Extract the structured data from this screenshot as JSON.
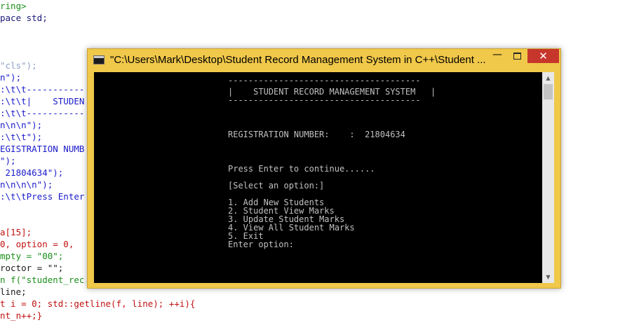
{
  "editor": {
    "lines": [
      {
        "text": "ring>",
        "color": "#1b8f1b"
      },
      {
        "text": "pace std;",
        "color": "#1a1a7a"
      },
      {
        "text": "",
        "color": "#000000"
      },
      {
        "text": "",
        "color": "#000000"
      },
      {
        "text": "\"cls\");",
        "color": "#8fa0c8"
      },
      {
        "text": "n\");",
        "color": "#1a1acb"
      },
      {
        "text": ":\\t\\t-----------",
        "color": "#1a1acb"
      },
      {
        "text": ":\\t\\t|    STUDEN",
        "color": "#1a1acb"
      },
      {
        "text": ":\\t\\t-----------",
        "color": "#1a1acb"
      },
      {
        "text": "n\\n\\n\");",
        "color": "#1a1acb"
      },
      {
        "text": ":\\t\\t\");",
        "color": "#1a1acb"
      },
      {
        "text": "EGISTRATION NUMB",
        "color": "#1a1acb"
      },
      {
        "text": "\");",
        "color": "#1a1acb"
      },
      {
        "text": " 21804634\");",
        "color": "#1a1acb"
      },
      {
        "text": "n\\n\\n\\n\");",
        "color": "#1a1acb"
      },
      {
        "text": ":\\t\\tPress Enter",
        "color": "#1a1acb"
      },
      {
        "text": "",
        "color": "#000000"
      },
      {
        "text": "a[15];",
        "color": "#c01010"
      },
      {
        "text": "0, option = 0,",
        "color": "#c01010"
      },
      {
        "text": "mpty = \"00\";",
        "color": "#1b8f1b"
      },
      {
        "text": "roctor = \"\";",
        "color": "#1a1a1a"
      },
      {
        "text": "n f(\"student_rec",
        "color": "#1b8f1b"
      },
      {
        "text": "line;",
        "color": "#1a1a1a"
      },
      {
        "text": "t i = 0; std::getline(f, line); ++i){",
        "color": "#c01010"
      },
      {
        "text": "nt_n++;}",
        "color": "#c01010"
      }
    ]
  },
  "window": {
    "title": "\"C:\\Users\\Mark\\Desktop\\Student Record Management System in C++\\Student ...",
    "minimize_label": "—",
    "close_label": "✕"
  },
  "console": {
    "lines": [
      {
        "text": "--------------------------------------"
      },
      {
        "text": "|    STUDENT RECORD MANAGEMENT SYSTEM   |"
      },
      {
        "text": "--------------------------------------"
      },
      {
        "text": "REGISTRATION NUMBER:    :  21804634"
      },
      {
        "text": "Press Enter to continue......"
      },
      {
        "text": "[Select an option:]"
      },
      {
        "text": "1. Add New Students"
      },
      {
        "text": "2. Student View Marks"
      },
      {
        "text": "3. Update Student Marks"
      },
      {
        "text": "4. View All Student Marks"
      },
      {
        "text": "5. Exit"
      },
      {
        "text": "Enter option:"
      }
    ]
  },
  "scrollbar": {
    "up_arrow": "▲",
    "down_arrow": "▼"
  }
}
